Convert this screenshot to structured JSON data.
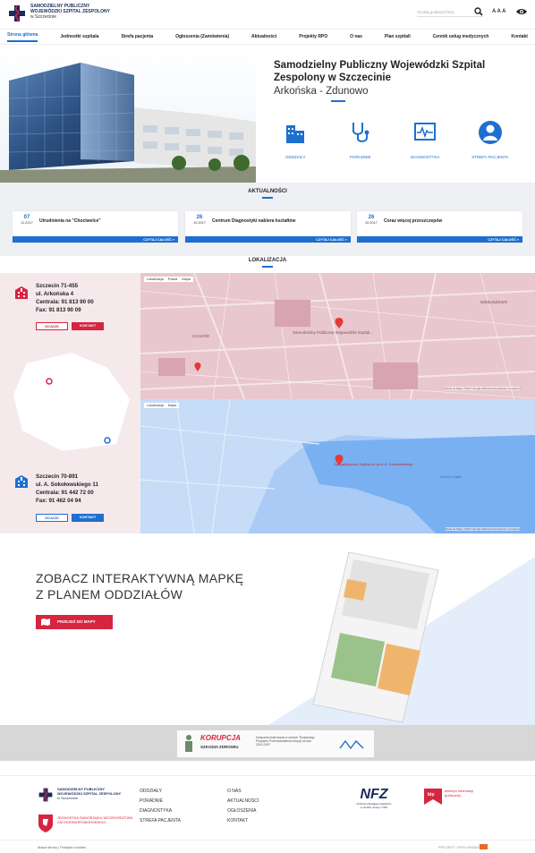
{
  "header": {
    "logo_line1": "SAMODZIELNY PUBLICZNY",
    "logo_line2": "WOJEWÓDZKI SZPITAL ZESPOLONY",
    "logo_line3": "w Szczecinie",
    "search_placeholder": "Szukaj podanej frazy",
    "font_size_label": "A A A",
    "icons": [
      "search-icon",
      "eye-icon"
    ]
  },
  "nav": [
    "Strona główna",
    "Jednostki szpitala",
    "Strefa pacjenta",
    "Ogłoszenia (Zamówienia)",
    "Aktualności",
    "Projekty RPO",
    "O nas",
    "Plan szpitali",
    "Cennik usług medycznych",
    "Kontakt"
  ],
  "hero": {
    "title": "Samodzielny Publiczny Wojewódzki Szpital Zespolony w Szczecinie",
    "location": "Arkońska - Zdunowo",
    "quick_links": [
      "ODDZIAŁY",
      "PORADNIE",
      "DIAGNOSTYKA",
      "STREFA PACJENTA"
    ]
  },
  "news": {
    "title": "AKTUALNOŚCI",
    "more_label": "CZYTAJ CAŁOŚĆ »",
    "items": [
      {
        "day": "07",
        "month": "11.2017",
        "title": "Utrudnienia na \"Chociwelce\""
      },
      {
        "day": "26",
        "month": "10.2017",
        "title": "Centrum Diagnostyki nabiera kształtów"
      },
      {
        "day": "26",
        "month": "10.2017",
        "title": "Coraz więcej przeszczepów"
      }
    ]
  },
  "locations": {
    "title": "LOKALIZACJA",
    "map_tabs": [
      "Lokalizacja",
      "Pokaż",
      "Mapa"
    ],
    "map_attr": "Dane do Mapy ©2017 Google   Warunki korzystania z programu",
    "btn_route": "DOJAZD",
    "btn_contact": "KONTAKT",
    "places": [
      {
        "l1": "Szczecin 71-455",
        "l2": "ul. Arkońska 4",
        "l3": "Centrala: 91 813 90 00",
        "l4": "Fax: 91 813 90 09",
        "marker": "Samodzielny Publiczny Wojewódzki Szpital..."
      },
      {
        "l1": "Szczecin 70-891",
        "l2": "ul. A. Sokołowskiego 11",
        "l3": "Centrala: 91 442 72 00",
        "l4": "Fax: 91 462 04 94",
        "marker": "Specjalistyczny Szpital im. prof. A. Sokołowskiego"
      }
    ],
    "map_labels": [
      "ZACHÓD",
      "NIEBUSZEWO",
      "Jezioro Dąbie"
    ]
  },
  "interactive": {
    "heading_line1": "ZOBACZ INTERAKTYWNĄ MAPKĘ",
    "heading_line2": "Z PLANEM ODDZIAŁÓW",
    "button": "PRZEJDŹ DO MAPY"
  },
  "anti": {
    "logo": "KORUPCJA",
    "sub": "SZKODZI ZDROWIU",
    "text": "Kampania realizowana w ramach \"Rządowego Programu Przeciwdziałania Korupcji na lata 2014-2019\""
  },
  "footer": {
    "col1": [
      "ODDZIAŁY",
      "PORADNIE",
      "DIAGNOSTYKA",
      "STREFA PACJENTA"
    ],
    "col2": [
      "O NAS",
      "AKTUALNOŚCI",
      "OGŁOSZENIA",
      "KONTAKT"
    ],
    "unit_text": "JEDNOSTKA SAMORZĄDU WOJEWÓDZTWA ZACHODNIOPOMORSKIEGO",
    "nfz": "NFZ",
    "nfz_sub": "Podmiot udzielający świadczeń w ramach umowy z NFZ",
    "bip": "biuletyn informacji publicznej",
    "bottom_left": "Mapa strony | Polityka cookies",
    "bottom_right": "PROJEKT I WYKONANIE"
  },
  "colors": {
    "accent": "#1e6fd0",
    "red": "#d7243f",
    "navy": "#1a2b5c"
  }
}
